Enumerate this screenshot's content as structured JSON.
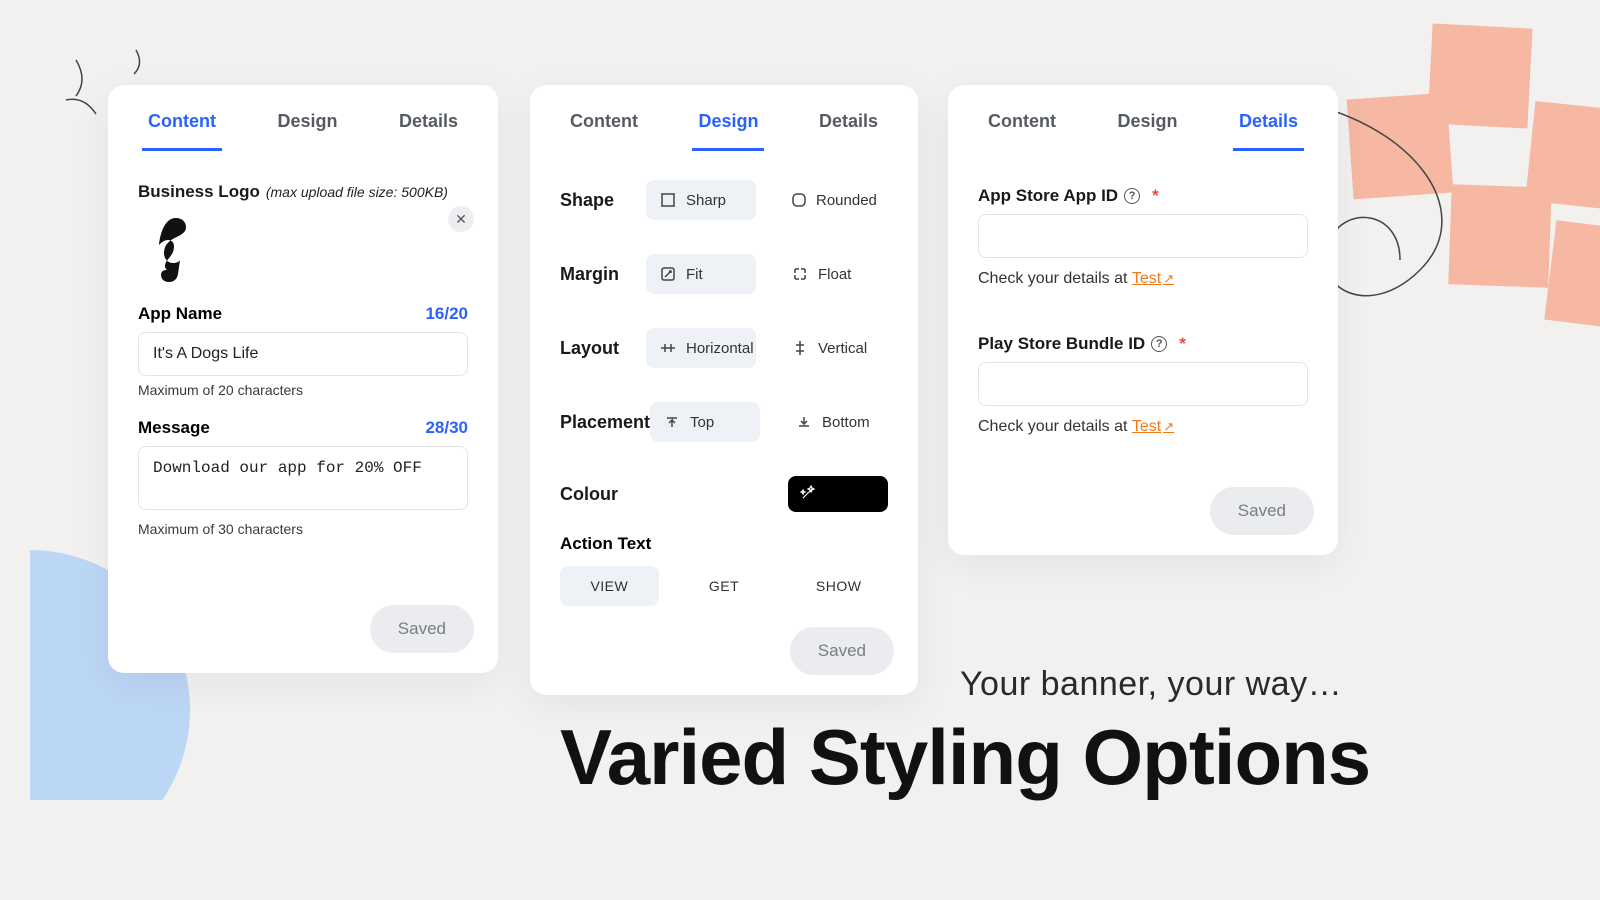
{
  "tabs": {
    "content": "Content",
    "design": "Design",
    "details": "Details"
  },
  "content": {
    "logo_label": "Business Logo",
    "logo_hint": "(max upload file size: 500KB)",
    "appname_label": "App Name",
    "appname_counter": "16/20",
    "appname_value": "It's A Dogs Life",
    "appname_hint": "Maximum of 20 characters",
    "msg_label": "Message",
    "msg_counter": "28/30",
    "msg_value": "Download our app for 20% OFF",
    "msg_hint": "Maximum of 30 characters",
    "saved": "Saved"
  },
  "design": {
    "shape": {
      "label": "Shape",
      "a": "Sharp",
      "b": "Rounded"
    },
    "margin": {
      "label": "Margin",
      "a": "Fit",
      "b": "Float"
    },
    "layout": {
      "label": "Layout",
      "a": "Horizontal",
      "b": "Vertical"
    },
    "placement": {
      "label": "Placement",
      "a": "Top",
      "b": "Bottom"
    },
    "colour_label": "Colour",
    "action_label": "Action Text",
    "actions": {
      "a": "VIEW",
      "b": "GET",
      "c": "SHOW"
    },
    "saved": "Saved"
  },
  "details": {
    "appstore_label": "App Store App ID",
    "playstore_label": "Play Store Bundle ID",
    "check_prefix": "Check your details at ",
    "test": "Test",
    "saved": "Saved"
  },
  "marketing": {
    "sub": "Your banner, your way…",
    "head_a": "Varied Styling ",
    "head_b": "Options"
  }
}
